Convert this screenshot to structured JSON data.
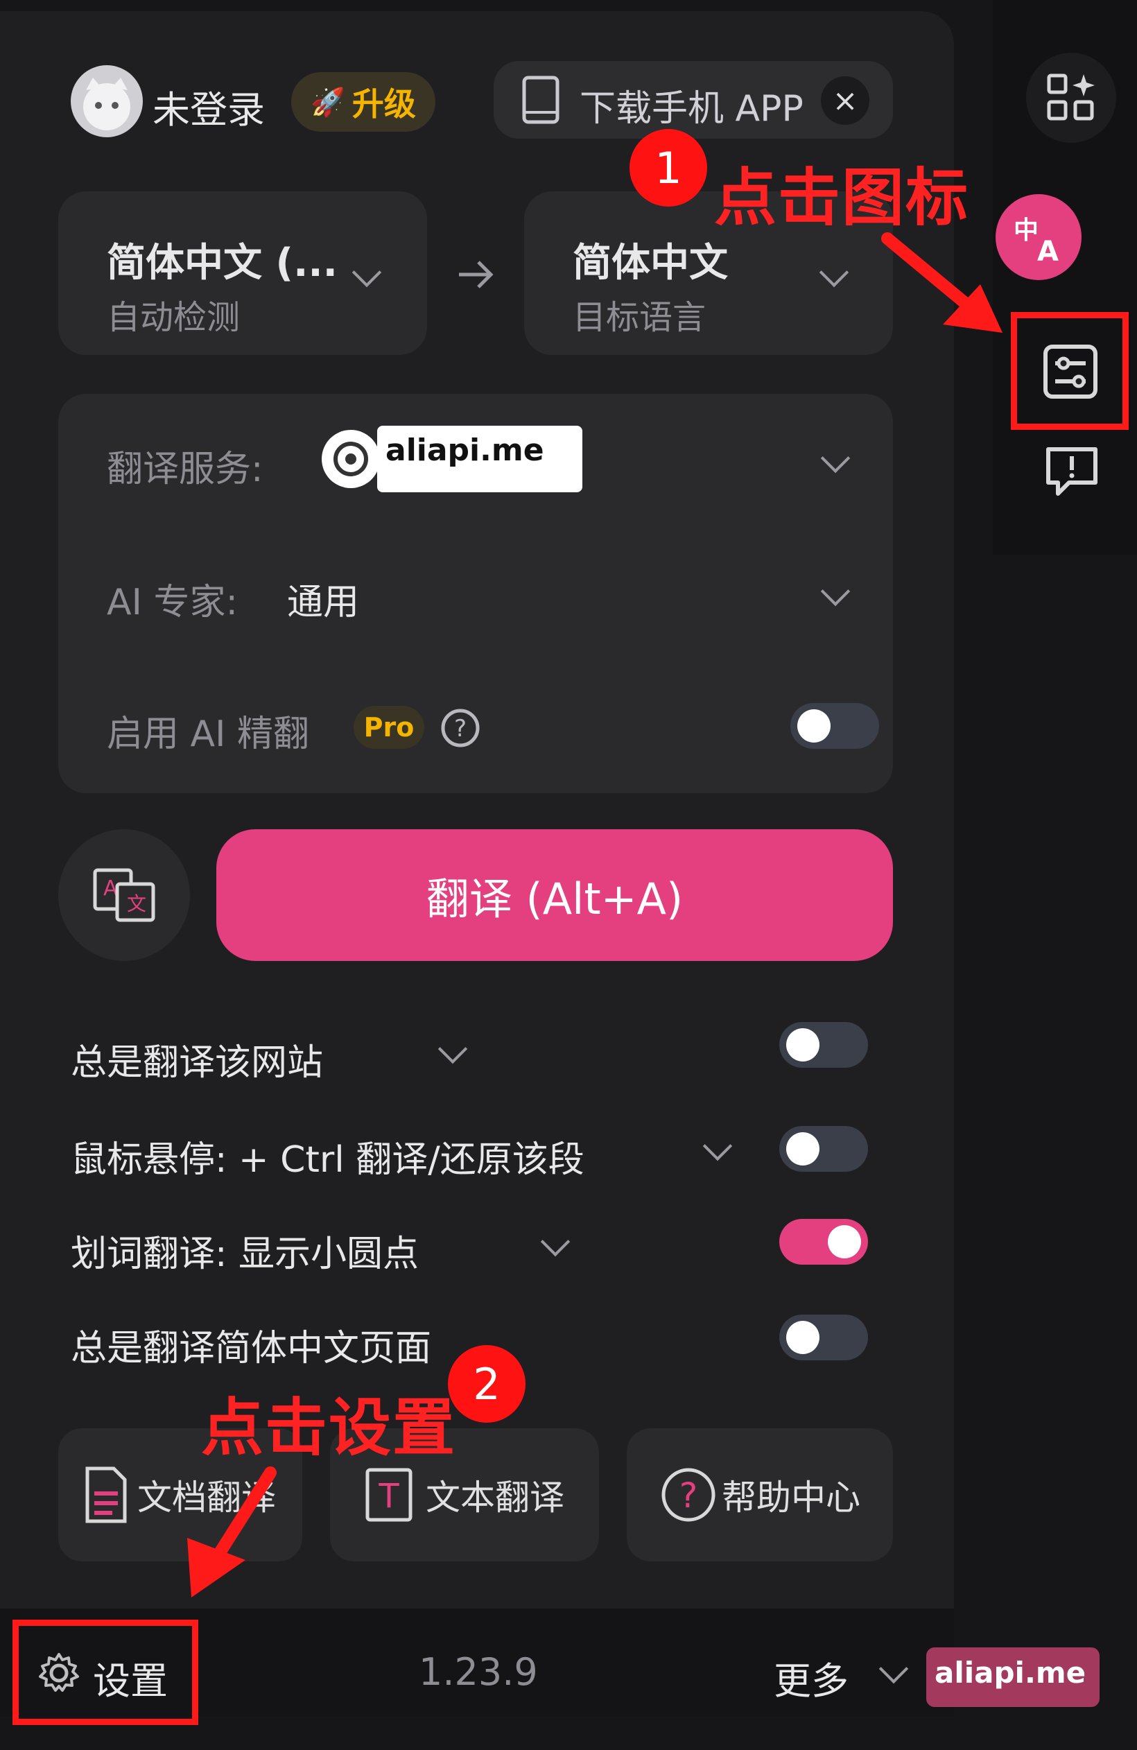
{
  "header": {
    "user_status": "未登录",
    "upgrade_label": "升级",
    "download_app_label": "下载手机 APP"
  },
  "languages": {
    "source_name": "简体中文 (...",
    "source_sub": "自动检测",
    "target_name": "简体中文",
    "target_sub": "目标语言"
  },
  "settings_card": {
    "service_label": "翻译服务:",
    "service_watermark": "aliapi.me",
    "expert_label": "AI 专家:",
    "expert_value": "通用",
    "refine_label": "启用 AI 精翻",
    "pro_badge": "Pro",
    "refine_enabled": false
  },
  "translate_button": "翻译 (Alt+A)",
  "options": [
    {
      "label": "总是翻译该网站",
      "enabled": false
    },
    {
      "label": "鼠标悬停:  + Ctrl 翻译/还原该段",
      "enabled": false
    },
    {
      "label": "划词翻译:  显示小圆点",
      "enabled": true
    },
    {
      "label": "总是翻译简体中文页面",
      "enabled": false
    }
  ],
  "bottom_buttons": {
    "doc": "文档翻译",
    "text": "文本翻译",
    "help": "帮助中心"
  },
  "footer": {
    "settings": "设置",
    "version": "1.23.9",
    "more": "更多",
    "watermark": "aliapi.me"
  },
  "annotations": {
    "step1_number": "1",
    "step1_text": "点击图标",
    "step2_number": "2",
    "step2_text": "点击设置"
  },
  "colors": {
    "accent": "#e4407f",
    "annotation_red": "#ff1a1a",
    "background": "#1f1f22"
  }
}
